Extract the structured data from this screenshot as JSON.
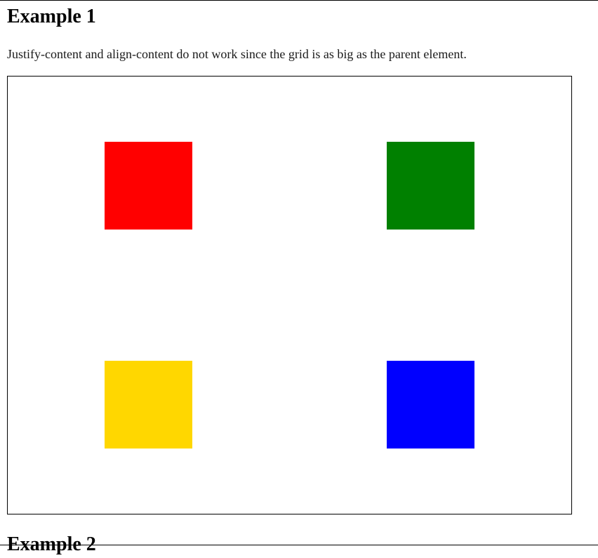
{
  "example1": {
    "title": "Example 1",
    "description": "Justify-content and align-content do not work since the grid is as big as the parent element."
  },
  "grid": {
    "items": [
      {
        "name": "red",
        "color": "#ff0000"
      },
      {
        "name": "green",
        "color": "#008000"
      },
      {
        "name": "yellow",
        "color": "#ffd700"
      },
      {
        "name": "blue",
        "color": "#0000ff"
      }
    ]
  },
  "example2": {
    "title": "Example 2"
  }
}
